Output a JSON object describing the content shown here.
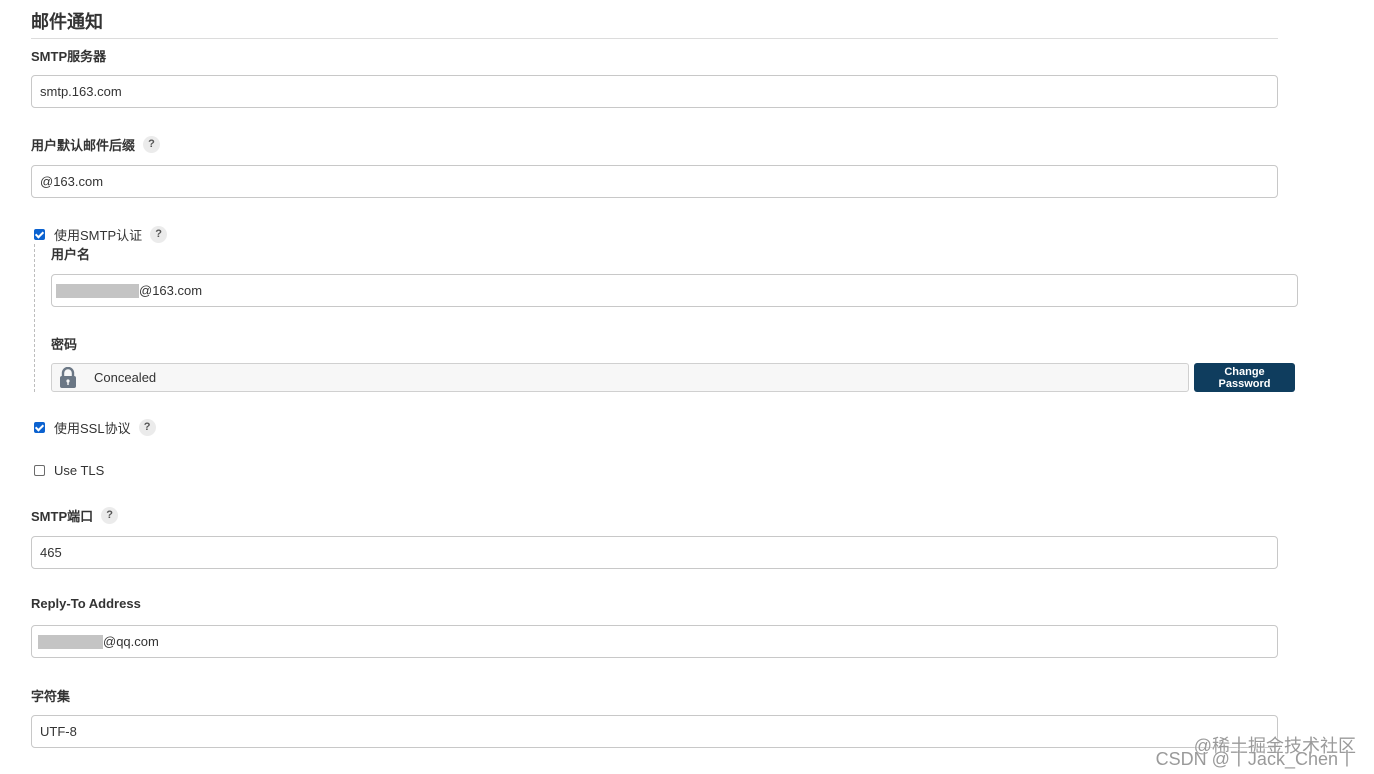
{
  "section": {
    "title": "邮件通知"
  },
  "smtp_server": {
    "label": "SMTP服务器",
    "value": "smtp.163.com"
  },
  "default_suffix": {
    "label": "用户默认邮件后缀",
    "value": "@163.com"
  },
  "smtp_auth": {
    "label": "使用SMTP认证",
    "checked": true,
    "username": {
      "label": "用户名",
      "value_suffix": "@163.com"
    },
    "password": {
      "label": "密码",
      "value": "Concealed",
      "change_button": "Change Password"
    }
  },
  "use_ssl": {
    "label": "使用SSL协议",
    "checked": true
  },
  "use_tls": {
    "label": "Use TLS",
    "checked": false
  },
  "smtp_port": {
    "label": "SMTP端口",
    "value": "465"
  },
  "reply_to": {
    "label": "Reply-To Address",
    "value_suffix": "@qq.com"
  },
  "charset": {
    "label": "字符集",
    "value": "UTF-8"
  },
  "help_symbol": "?",
  "watermark": {
    "line1": "@稀土掘金技术社区",
    "line2": "CSDN @丨Jack_Chen丨"
  },
  "icons": {
    "lock": "lock-icon",
    "help": "help-icon"
  },
  "colors": {
    "accent": "#0b62d0",
    "button": "#0f3d5e"
  }
}
